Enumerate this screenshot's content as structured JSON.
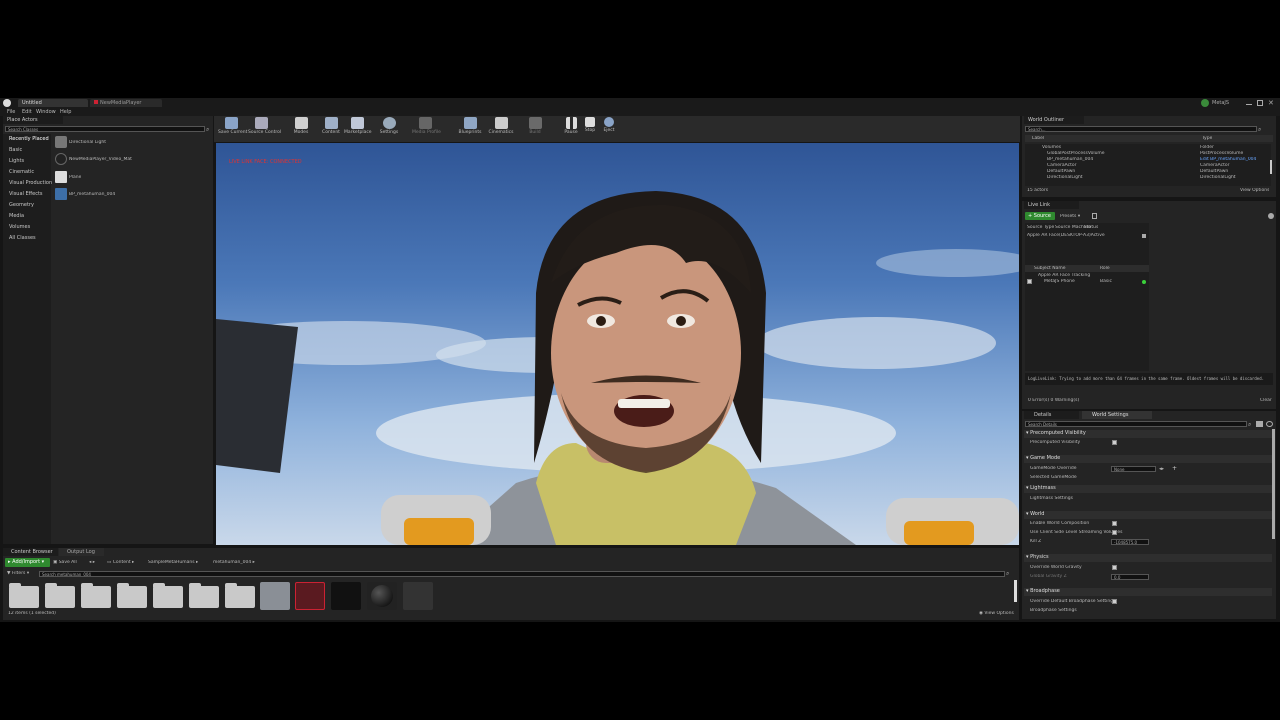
{
  "window": {
    "tabs": [
      "Untitled",
      "NewMediaPlayer"
    ],
    "menu": [
      "File",
      "Edit",
      "Window",
      "Help"
    ],
    "profile": "MetaJS"
  },
  "place_actors": {
    "tab": "Place Actors",
    "search_placeholder": "Search Classes",
    "categories": [
      "Recently Placed",
      "Basic",
      "Lights",
      "Cinematic",
      "Visual Production",
      "Visual Effects",
      "Geometry",
      "Media",
      "Volumes",
      "All Classes"
    ],
    "items": [
      "Directional Light",
      "NewMediaPlayer_Video_Mat",
      "Plane",
      "BP_metahuman_004"
    ]
  },
  "toolbar": {
    "buttons": [
      "Save Current",
      "Source Control",
      "Modes",
      "Content",
      "Marketplace",
      "Settings",
      "Media Profile",
      "Blueprints",
      "Cinematics",
      "Build",
      "Pause",
      "Stop",
      "Eject"
    ]
  },
  "viewport": {
    "overlay_text": "LIVE LINK FACE: CONNECTED"
  },
  "world_outliner": {
    "tab": "World Outliner",
    "search_placeholder": "Search...",
    "col_label": "Label",
    "col_type": "Type",
    "rows": [
      {
        "label": "Volumes",
        "type": "Folder"
      },
      {
        "label": "GlobalPostProcessVolume",
        "type": "PostProcessVolume"
      },
      {
        "label": "BP_metahuman_004",
        "type": "Edit BP_metahuman_004"
      },
      {
        "label": "CameraActor",
        "type": "CameraActor"
      },
      {
        "label": "DefaultPawn",
        "type": "DefaultPawn"
      },
      {
        "label": "DirectionalLight",
        "type": "DirectionalLight"
      }
    ],
    "count": "15 actors",
    "view_options": "View Options"
  },
  "live_link": {
    "tab": "Live Link",
    "source_button": "Source",
    "presets_button": "Presets",
    "cols": [
      "Source Type",
      "Source Machine",
      "Status"
    ],
    "source_row": "Apple AR Face(DESKTOP-A3)Active",
    "subject_cols": [
      "Subject Name",
      "Role"
    ],
    "subject_group": "Apple AR Face Tracking",
    "subject_name": "MetaJS Phone",
    "subject_role": "Basic",
    "log": "LogLiveLink: Trying to add more than 64 frames in the same frame. Oldest frames will be discarded.",
    "log_count": "0 Error(s) 0 Warning(s)",
    "clear": "Clear"
  },
  "details": {
    "tabs": [
      "Details",
      "World Settings"
    ],
    "search_placeholder": "Search Details",
    "sections": [
      {
        "title": "Precomputed Visibility",
        "rows": [
          "Precomputed Visibility"
        ]
      },
      {
        "title": "Game Mode",
        "rows": [
          "GameMode Override",
          "Selected GameMode"
        ]
      },
      {
        "title": "Lightmass",
        "rows": [
          "Lightmass Settings"
        ]
      },
      {
        "title": "World",
        "rows": [
          "Enable World Composition",
          "Use Client Side Level Streaming Volumes",
          "Kill Z"
        ]
      },
      {
        "title": "Physics",
        "rows": [
          "Override World Gravity",
          "Global Gravity Z"
        ]
      },
      {
        "title": "Broadphase",
        "rows": [
          "Override Default Broadphase Settings",
          "Broadphase Settings"
        ]
      }
    ],
    "gamemode_value": "None",
    "kill_z_value": "-1048575.0",
    "gravity_value": "0.0"
  },
  "content_browser": {
    "tabs": [
      "Content Browser",
      "Output Log"
    ],
    "add_import": "Add/Import",
    "save_all": "Save All",
    "path": [
      "Content",
      "SampleMetaHumans",
      "metahuman_004"
    ],
    "filters": "Filters",
    "search_placeholder": "Search metahuman_004",
    "status": "12 items (1 selected)",
    "view_options": "View Options"
  },
  "colors": {
    "accent_green": "#4caf50",
    "selection_blue": "#2f5d8a",
    "viewport_sky": "#3f6aa8"
  }
}
